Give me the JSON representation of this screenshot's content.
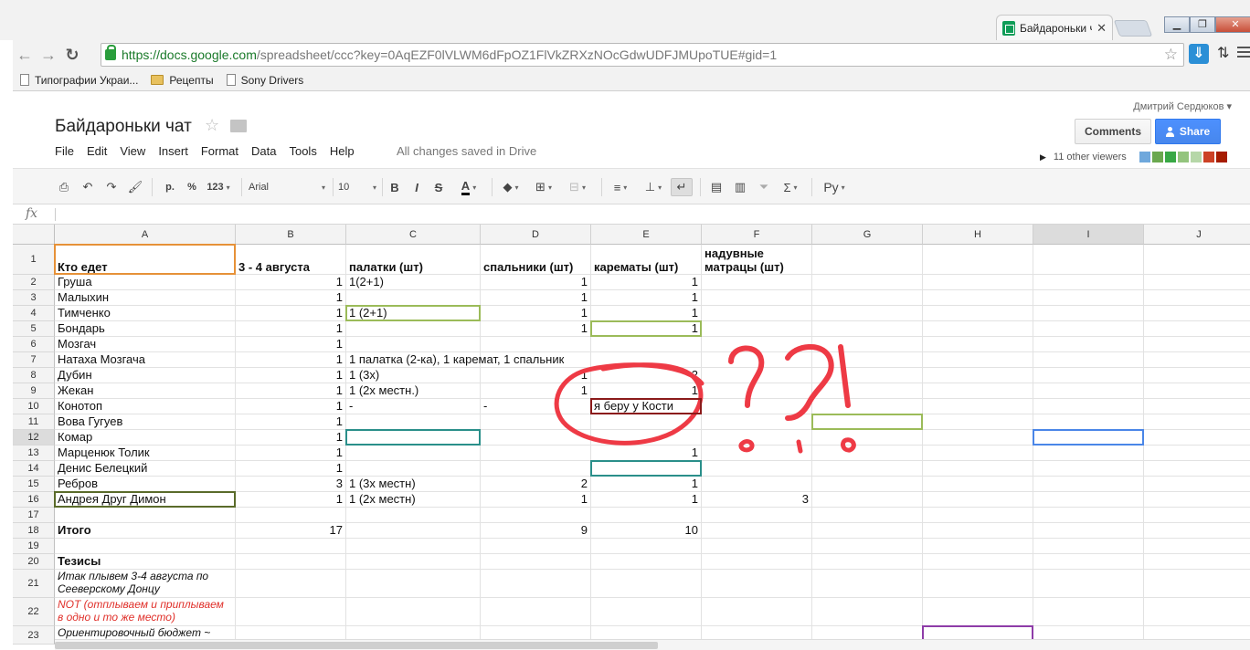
{
  "browser": {
    "tab_title": "Байдароньки ч",
    "tab_close": "✕",
    "url_host": "https://docs.google.com",
    "url_rest": "/spreadsheet/ccc?key=0AqEZF0lVLWM6dFpOZ1FlVkZRXzNOcGdwUDFJMUpoTUE#gid=1",
    "bookmarks": [
      "Типографии Украи...",
      "Рецепты",
      "Sony Drivers"
    ]
  },
  "doc": {
    "title": "Байдароньки чат",
    "menu": [
      "File",
      "Edit",
      "View",
      "Insert",
      "Format",
      "Data",
      "Tools",
      "Help"
    ],
    "save_status": "All changes saved in Drive",
    "user": "Дмитрий Сердюков ▾",
    "comments_label": "Comments",
    "share_label": "Share",
    "viewers_label": "11 other viewers",
    "viewer_colors": [
      "#6fa8dc",
      "#6aa84f",
      "#38a845",
      "#93c47d",
      "#b6d7a8",
      "#cc4125",
      "#a61c00"
    ]
  },
  "toolbar": {
    "currency": "р.",
    "percent": "%",
    "number_format": "123",
    "font": "Arial",
    "font_size": "10",
    "bold": "B",
    "italic": "I",
    "strike": "S",
    "text_color": "A",
    "input_tool": "Ру"
  },
  "formula_bar": {
    "fx": "fx",
    "value": ""
  },
  "columns": [
    "A",
    "B",
    "C",
    "D",
    "E",
    "F",
    "G",
    "H",
    "I",
    "J"
  ],
  "rows": [
    {
      "num": "1",
      "A": "Кто едет",
      "B": "3 - 4 августа",
      "C": "палатки (шт)",
      "D": "спальники (шт)",
      "E": "карематы (шт)",
      "F": "надувные матрацы (шт)"
    },
    {
      "num": "2",
      "A": "Груша",
      "B": "1",
      "C": "1(2+1)",
      "D": "1",
      "E": "1"
    },
    {
      "num": "3",
      "A": "Малыхин",
      "B": "1",
      "D": "1",
      "E": "1"
    },
    {
      "num": "4",
      "A": "Тимченко",
      "B": "1",
      "C": "1 (2+1)",
      "D": "1",
      "E": "1"
    },
    {
      "num": "5",
      "A": "Бондарь",
      "B": "1",
      "D": "1",
      "E": "1"
    },
    {
      "num": "6",
      "A": "Мозгач",
      "B": "1"
    },
    {
      "num": "7",
      "A": "Натаха Мозгача",
      "B": "1",
      "C": "1 палатка (2-ка), 1 каремат, 1 спальник"
    },
    {
      "num": "8",
      "A": "Дубин",
      "B": "1",
      "C": "1 (3х)",
      "D": "1",
      "E": "2"
    },
    {
      "num": "9",
      "A": "Жекан",
      "B": "1",
      "C": "1 (2х местн.)",
      "D": "1",
      "E": "1"
    },
    {
      "num": "10",
      "A": "Конотоп",
      "B": "1",
      "C": "-",
      "D": "-",
      "E": "я беру у Кости"
    },
    {
      "num": "11",
      "A": "Вова Гугуев",
      "B": "1"
    },
    {
      "num": "12",
      "A": "Комар",
      "B": "1"
    },
    {
      "num": "13",
      "A": "Марценюк Толик",
      "B": "1",
      "E": "1"
    },
    {
      "num": "14",
      "A": "Денис Белецкий",
      "B": "1"
    },
    {
      "num": "15",
      "A": "Ребров",
      "B": "3",
      "C": "1 (3х местн)",
      "D": "2",
      "E": "1"
    },
    {
      "num": "16",
      "A": "Андрея Друг Димон",
      "B": "1",
      "C": "1 (2х местн)",
      "D": "1",
      "E": "1",
      "F": "3"
    },
    {
      "num": "17"
    },
    {
      "num": "18",
      "A": "Итого",
      "B": "17",
      "D": "9",
      "E": "10"
    },
    {
      "num": "19"
    },
    {
      "num": "20",
      "A": "Тезисы"
    },
    {
      "num": "21",
      "A": "Итак плывем 3-4 августа по Сееверскому Донцу"
    },
    {
      "num": "22",
      "A": "NOT (отплываем и приплываем в одно и то же место)"
    },
    {
      "num": "23",
      "A": "Ориентировочный бюджет ~"
    }
  ],
  "colors": {
    "annotation_red": "#ee3a45",
    "share_blue": "#4d90fe",
    "active_border_orange": "#e69138",
    "collab_green": "#9bbb59",
    "collab_teal": "#2a8f8a",
    "collab_darkred": "#8b1a1a",
    "collab_olive": "#5a6b2a",
    "collab_blue": "#4a86e8",
    "collab_purple": "#8e3ca8"
  }
}
